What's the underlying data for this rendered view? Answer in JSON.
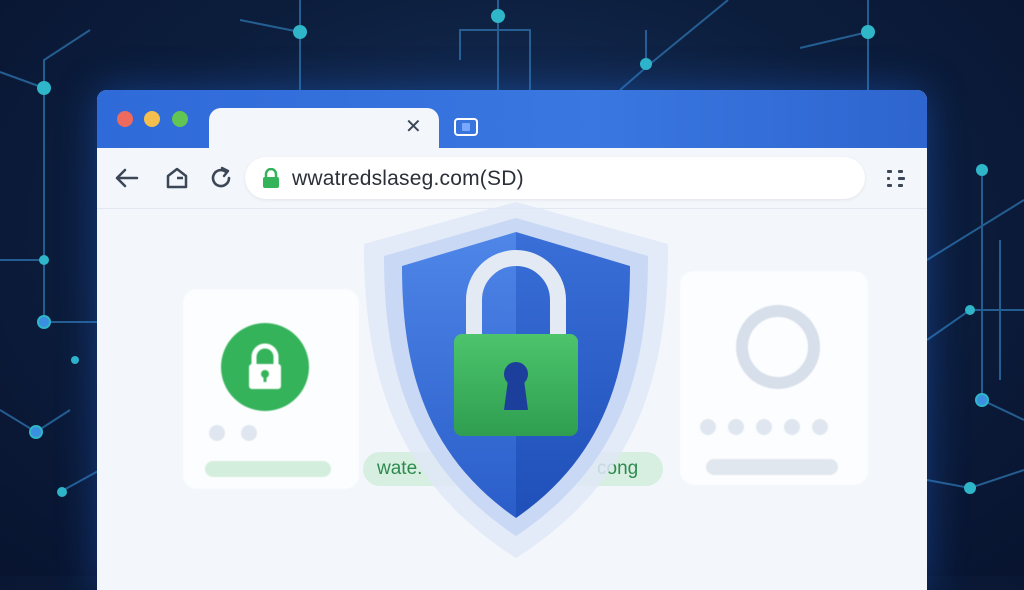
{
  "browser": {
    "tab_close": "✕",
    "address": {
      "url": "wwatredslaseg.com(SD)"
    }
  },
  "content": {
    "pill": {
      "text_left": "wate.",
      "text_right": "cong"
    }
  },
  "colors": {
    "background": "#0c1d3c",
    "tabbar": "#3a77e0",
    "accent_blue": "#2f6ad9",
    "secure_green": "#34b35a",
    "circuit_node": "#2fb6c9"
  },
  "icons": {
    "back": "arrow-left-icon",
    "home": "home-icon",
    "reload": "reload-icon",
    "lock": "padlock-icon",
    "menu": "grid-dots-icon",
    "shield": "shield-lock-icon"
  }
}
